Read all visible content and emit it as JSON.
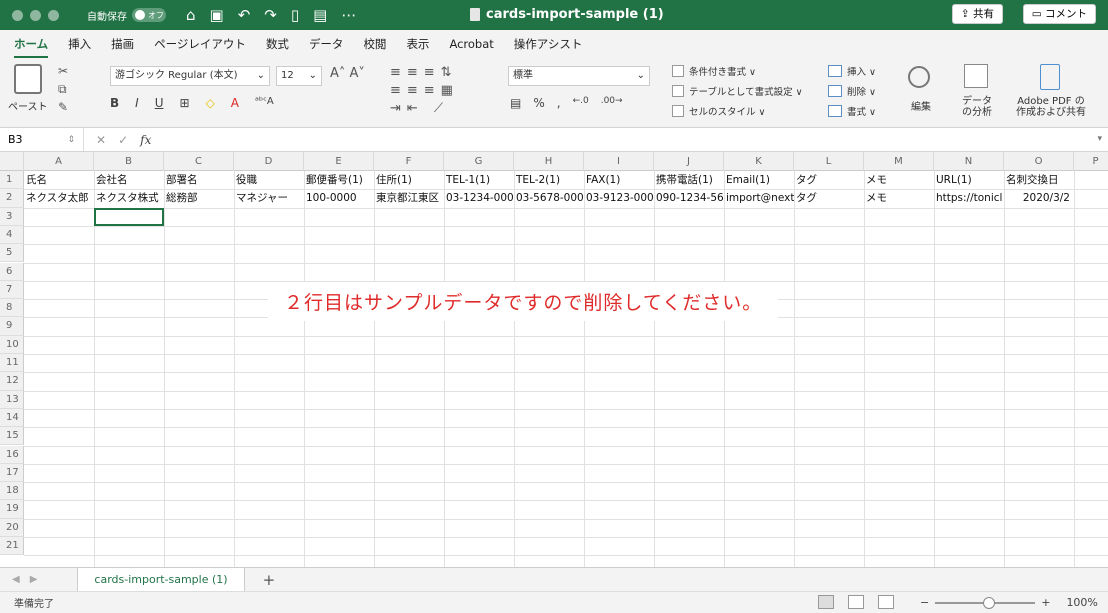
{
  "window": {
    "title": "cards-import-sample (1)",
    "autosave_label": "自動保存",
    "autosave_state": "オフ"
  },
  "ribbon_tabs": [
    "ホーム",
    "挿入",
    "描画",
    "ページレイアウト",
    "数式",
    "データ",
    "校閲",
    "表示",
    "Acrobat",
    "操作アシスト"
  ],
  "share_label": "共有",
  "comment_label": "コメント",
  "ribbon": {
    "paste_label": "ペースト",
    "font_name": "游ゴシック Regular (本文)",
    "font_size": "12",
    "number_format": "標準",
    "conditional_format": "条件付き書式 ∨",
    "table_format": "テーブルとして書式設定 ∨",
    "cell_style": "セルのスタイル ∨",
    "insert": "挿入 ∨",
    "delete": "削除 ∨",
    "format": "書式 ∨",
    "edit": "編集",
    "analysis_line1": "データ",
    "analysis_line2": "の分析",
    "pdf_line1": "Adobe PDF の",
    "pdf_line2": "作成および共有"
  },
  "formula_bar": {
    "name_box": "B3",
    "fx": "fx"
  },
  "columns": [
    "A",
    "B",
    "C",
    "D",
    "E",
    "F",
    "G",
    "H",
    "I",
    "J",
    "K",
    "L",
    "M",
    "N",
    "O",
    "P"
  ],
  "rows": [
    "1",
    "2",
    "3",
    "4",
    "5",
    "6",
    "7",
    "8",
    "9",
    "10",
    "11",
    "12",
    "13",
    "14",
    "15",
    "16",
    "17",
    "18",
    "19",
    "20",
    "21"
  ],
  "header_row": [
    "氏名",
    "会社名",
    "部署名",
    "役職",
    "郵便番号(1)",
    "住所(1)",
    "TEL-1(1)",
    "TEL-2(1)",
    "FAX(1)",
    "携帯電話(1)",
    "Email(1)",
    "タグ",
    "メモ",
    "URL(1)",
    "名刺交換日"
  ],
  "data_row": [
    "ネクスタ太郎",
    "ネクスタ株式",
    "総務部",
    "マネジャー",
    "100-0000",
    "東京都江東区",
    "03-1234-000",
    "03-5678-000",
    "03-9123-000",
    "090-1234-56",
    "import@nexta",
    "タグ",
    "メモ",
    "https://tonicl",
    "2020/3/2"
  ],
  "note": "２行目はサンプルデータですので削除してください。",
  "sheet_tab": "cards-import-sample (1)",
  "add_sheet": "+",
  "status": "準備完了",
  "zoom": "100%"
}
